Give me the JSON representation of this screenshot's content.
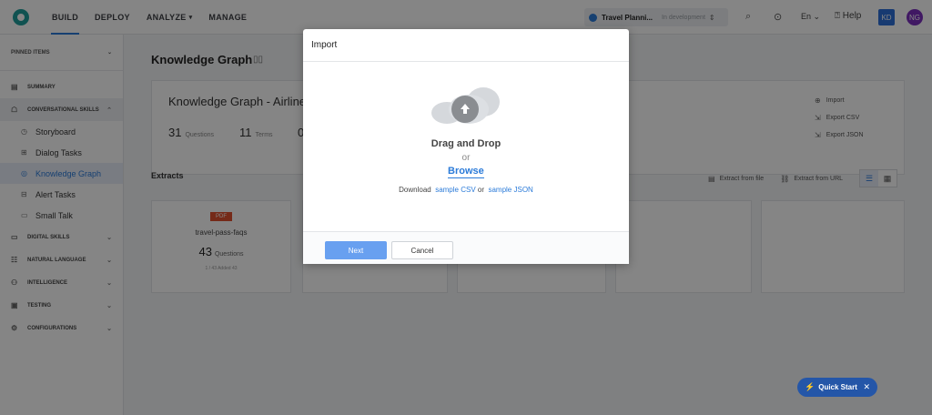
{
  "topbar": {
    "nav": [
      {
        "label": "BUILD",
        "active": true,
        "has_caret": false
      },
      {
        "label": "DEPLOY",
        "active": false,
        "has_caret": false
      },
      {
        "label": "ANALYZE",
        "active": false,
        "has_caret": true
      },
      {
        "label": "MANAGE",
        "active": false,
        "has_caret": false
      }
    ],
    "bot_name": "Travel Planni...",
    "bot_status": "In development",
    "language": "En",
    "help_label": "Help",
    "avatar_kd": "KD",
    "avatar_ng": "NG",
    "colors": {
      "accent": "#2b7bd9",
      "avatar_kd": "#2d6fd8",
      "avatar_ng": "#7b2fbf",
      "logo": "#1f9e9b"
    }
  },
  "sidebar": {
    "pinned_label": "PINNED ITEMS",
    "summary": "SUMMARY",
    "conversational_skills": "CONVERSATIONAL SKILLS",
    "sub_items": [
      {
        "label": "Storyboard",
        "icon": "clock-icon",
        "active": false
      },
      {
        "label": "Dialog Tasks",
        "icon": "grid-icon",
        "active": false
      },
      {
        "label": "Knowledge Graph",
        "icon": "graph-icon",
        "active": true
      },
      {
        "label": "Alert Tasks",
        "icon": "alert-icon",
        "active": false
      },
      {
        "label": "Small Talk",
        "icon": "chat-icon",
        "active": false
      }
    ],
    "sections": [
      "DIGITAL SKILLS",
      "NATURAL LANGUAGE",
      "INTELLIGENCE",
      "TESTING",
      "CONFIGURATIONS"
    ]
  },
  "main": {
    "page_title": "Knowledge Graph",
    "kg_name": "Knowledge Graph - Airline",
    "questions_count": "31",
    "questions_label": "Questions",
    "terms_count": "11",
    "terms_label": "Terms",
    "third_count": "0",
    "actions": [
      "Import",
      "Export CSV",
      "Export JSON"
    ],
    "extracts_label": "Extracts",
    "extract_from_file": "Extract from file",
    "extract_from_url": "Extract from URL",
    "extract_card": {
      "badge": "PDF",
      "title": "travel-pass-faqs",
      "count": "43",
      "count_label": "Questions",
      "meta": "1 / 43 Added 43"
    }
  },
  "modal": {
    "title": "Import",
    "drag_drop": "Drag and Drop",
    "or": "or",
    "browse": "Browse",
    "download_prefix": "Download",
    "sample_csv": "sample CSV",
    "or_small": "or",
    "sample_json": "sample JSON",
    "next_label": "Next",
    "cancel_label": "Cancel"
  },
  "quick_start": {
    "label": "Quick Start",
    "close": "✕"
  }
}
